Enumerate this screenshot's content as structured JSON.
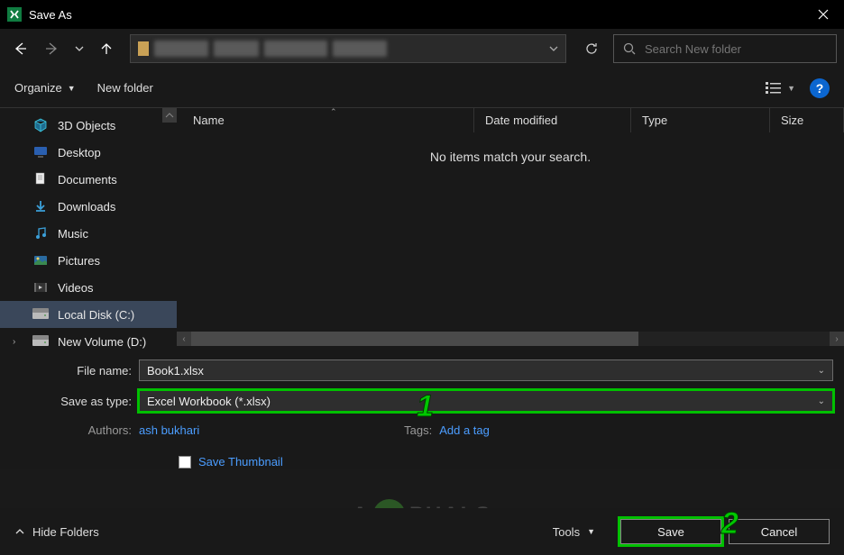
{
  "title": "Save As",
  "nav": {
    "search_placeholder": "Search New folder"
  },
  "toolbar": {
    "organize": "Organize",
    "newfolder": "New folder"
  },
  "sidebar": {
    "items": [
      {
        "label": "3D Objects",
        "icon": "cube"
      },
      {
        "label": "Desktop",
        "icon": "desktop"
      },
      {
        "label": "Documents",
        "icon": "doc"
      },
      {
        "label": "Downloads",
        "icon": "download"
      },
      {
        "label": "Music",
        "icon": "music"
      },
      {
        "label": "Pictures",
        "icon": "pictures"
      },
      {
        "label": "Videos",
        "icon": "videos"
      },
      {
        "label": "Local Disk (C:)",
        "icon": "disk",
        "selected": true
      },
      {
        "label": "New Volume (D:)",
        "icon": "disk",
        "expand": true
      }
    ]
  },
  "columns": {
    "name": "Name",
    "date": "Date modified",
    "type": "Type",
    "size": "Size"
  },
  "content": {
    "empty": "No items match your search."
  },
  "form": {
    "filename_label": "File name:",
    "filename_value": "Book1.xlsx",
    "type_label": "Save as type:",
    "type_value": "Excel Workbook (*.xlsx)",
    "authors_label": "Authors:",
    "authors_value": "ash bukhari",
    "tags_label": "Tags:",
    "tags_value": "Add a tag",
    "thumb_label": "Save Thumbnail"
  },
  "footer": {
    "hide": "Hide Folders",
    "tools": "Tools",
    "save": "Save",
    "cancel": "Cancel"
  },
  "callouts": {
    "c1": "1",
    "c2": "2"
  },
  "watermark": {
    "left": "A",
    "right": "PUALS"
  }
}
